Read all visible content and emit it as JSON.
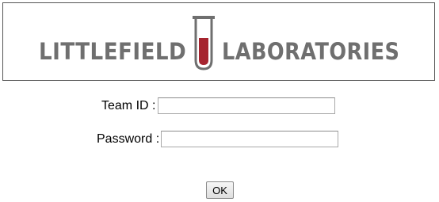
{
  "banner": {
    "left_word": "LITTLEFIELD",
    "right_word": "LABORATORIES",
    "text_color": "#6f6f6f",
    "tube_fill_color": "#a6242f"
  },
  "login_form": {
    "team_id_label": "Team ID :",
    "team_id_value": "",
    "password_label": "Password :",
    "password_value": "",
    "ok_label": "OK"
  }
}
